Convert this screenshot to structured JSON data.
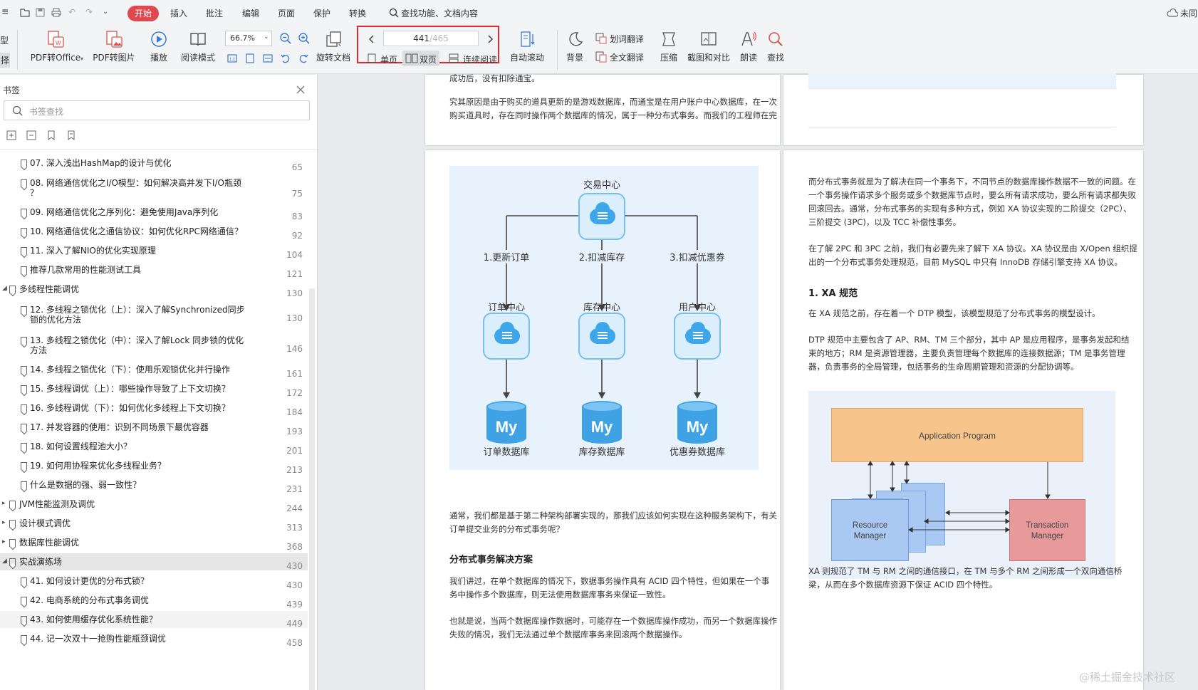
{
  "menubar": {
    "items": [
      "开始",
      "插入",
      "批注",
      "编辑",
      "页面",
      "保护",
      "转换"
    ],
    "search": "查找功能、文档内容",
    "sync": "未同"
  },
  "toolbar": {
    "left_partial": [
      "型",
      "择"
    ],
    "pdf_to_office": "PDF转Office",
    "pdf_to_image": "PDF转图片",
    "play": "播放",
    "read_mode": "阅读模式",
    "zoom": "66.7%",
    "rotate": "旋转文档",
    "page_current": "441",
    "page_total": "/465",
    "single_page": "单页",
    "double_page": "双页",
    "continuous": "连续阅读",
    "auto_scroll": "自动滚动",
    "background": "背景",
    "word_translate": "划词翻译",
    "full_translate": "全文翻译",
    "compress": "压缩",
    "screenshot_compare": "截图和对比",
    "read_aloud": "朗读",
    "find": "查找"
  },
  "sidebar": {
    "title": "书签",
    "search_placeholder": "书签查找",
    "items": [
      {
        "text": "07. 深入浅出HashMap的设计与优化",
        "page": "65"
      },
      {
        "text": "08. 网络通信优化之I/O模型：如何解决高并发下I/O瓶颈",
        "text2": "？",
        "page": "75"
      },
      {
        "text": "09. 网络通信优化之序列化：避免使用Java序列化",
        "page": "83"
      },
      {
        "text": "10. 网络通信优化之通信协议：如何优化RPC网络通信？",
        "page": "92"
      },
      {
        "text": "11. 深入了解NIO的优化实现原理",
        "page": "104"
      },
      {
        "text": "推荐几款常用的性能测试工具",
        "page": "121"
      },
      {
        "text": "多线程性能调优",
        "page": "130"
      },
      {
        "text": "12. 多线程之锁优化（上）：深入了解Synchronized同步",
        "text2": "锁的优化方法",
        "page": "130"
      },
      {
        "text": "13. 多线程之锁优化（中）：深入了解Lock 同步锁的优化",
        "text2": "方法",
        "page": "146"
      },
      {
        "text": "14. 多线程之锁优化（下）：使用乐观锁优化并行操作",
        "page": "161"
      },
      {
        "text": "15. 多线程调优（上）：哪些操作导致了上下文切换？",
        "page": "172"
      },
      {
        "text": "16. 多线程调优（下）：如何优化多线程上下文切换？",
        "page": "184"
      },
      {
        "text": "17. 并发容器的使用：识别不同场景下最优容器",
        "page": "193"
      },
      {
        "text": "18. 如何设置线程池大小？",
        "page": "201"
      },
      {
        "text": "19. 如何用协程来优化多线程业务？",
        "page": "213"
      },
      {
        "text": "什么是数据的强、弱一致性？",
        "page": "231"
      },
      {
        "text": "JVM性能监测及调优",
        "page": "244"
      },
      {
        "text": "设计模式调优",
        "page": "313"
      },
      {
        "text": "数据库性能调优",
        "page": "368"
      },
      {
        "text": "实战演练场",
        "page": "430"
      },
      {
        "text": "41. 如何设计更优的分布式锁？",
        "page": "430"
      },
      {
        "text": "42. 电商系统的分布式事务调优",
        "page": "439"
      },
      {
        "text": "43. 如何使用缓存优化系统性能？",
        "page": "449"
      },
      {
        "text": "44. 记一次双十一抢购性能瓶颈调优",
        "page": "458"
      }
    ]
  },
  "page_top_left": {
    "line1": "成功后，没有扣除通宝。",
    "para": [
      "究其原因是由于购买的道具更新的是游戏数据库，而通宝是在用户账户中心数据库，在一次",
      "购买道具时，存在同时操作两个数据库的情况，属于一种分布式事务。而我们的工程师在完"
    ]
  },
  "diagram": {
    "top": "交易中心",
    "branches": [
      "1.更新订单",
      "2.扣减库存",
      "3.扣减优惠券"
    ],
    "services": [
      "订单中心",
      "库存中心",
      "用户中心"
    ],
    "databases": [
      "订单数据库",
      "库存数据库",
      "优惠券数据库"
    ],
    "db_mark": "My"
  },
  "page_left": {
    "p1": [
      "通常，我们都是基于第二种架构部署实现的，那我们应该如何实现在这种服务架构下，有关",
      "订单提交业务的分布式事务呢？"
    ],
    "h1": "分布式事务解决方案",
    "p2": [
      "我们讲过，在单个数据库的情况下，数据事务操作具有 ACID 四个特性，但如果在一个事",
      "务中操作多个数据库，则无法使用数据库事务来保证一致性。"
    ],
    "p3": [
      "也就是说，当两个数据库操作数据时，可能存在一个数据库操作成功，而另一个数据库操作",
      "失败的情况，我们无法通过单个数据库事务来回滚两个数据操作。"
    ]
  },
  "page_right": {
    "p1": [
      "而分布式事务就是为了解决在同一个事务下，不同节点的数据库操作数据不一致的问题。在",
      "一个事务操作请求多个服务或多个数据库节点时，要么所有请求成功，要么所有请求都失败",
      "回滚回去。通常，分布式事务的实现有多种方式，例如 XA 协议实现的二阶提交（2PC）、",
      "三阶提交 (3PC)，以及 TCC 补偿性事务。"
    ],
    "p2": [
      "在了解 2PC 和 3PC 之前，我们有必要先来了解下 XA 协议。XA 协议是由 X/Open 组织提",
      "出的一个分布式事务处理规范，目前 MySQL 中只有 InnoDB 存储引擎支持 XA 协议。"
    ],
    "h1": "1. XA 规范",
    "p3": "在 XA 规范之前，存在着一个 DTP 模型，该模型规范了分布式事务的模型设计。",
    "p4": [
      "DTP 规范中主要包含了 AP、RM、TM 三个部分，其中 AP 是应用程序，是事务发起和结",
      "束的地方；RM 是资源管理器，主要负责管理每个数据库的连接数据源；TM 是事务管理",
      "器，负责事务的全局管理，包括事务的生命周期管理和资源的分配协调等。"
    ],
    "xa_app": "Application Program",
    "xa_rm": [
      "Resource",
      "Manager"
    ],
    "xa_tm": [
      "Transaction",
      "Manager"
    ],
    "p5": [
      "XA 则规范了 TM 与 RM 之间的通信接口，在 TM 与多个 RM 之间形成一个双向通信桥",
      "梁，从而在多个数据库资源下保证 ACID 四个特性。"
    ]
  },
  "watermark": "@稀土掘金技术社区",
  "colors": {
    "accent": "#e0484f",
    "highlight_box": "#e0282e",
    "diagram_bg": "#e8f2fc"
  }
}
